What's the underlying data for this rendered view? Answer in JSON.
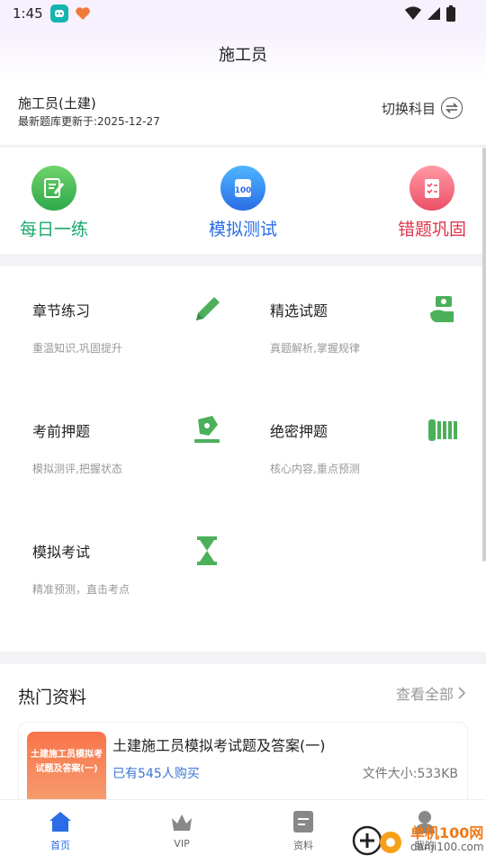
{
  "status_bar": {
    "time": "1:45"
  },
  "header": {
    "title": "施工员"
  },
  "subject": {
    "name": "施工员(土建)",
    "update_text": "最新题库更新于:2025-12-27",
    "switch_label": "切换科目"
  },
  "quick_actions": [
    {
      "label": "每日一练",
      "color": "#19a96a",
      "icon": "daily-practice-icon"
    },
    {
      "label": "模拟测试",
      "color": "#2a6de6",
      "icon": "mock-test-icon"
    },
    {
      "label": "错题巩固",
      "color": "#e0344a",
      "icon": "wrong-questions-icon"
    }
  ],
  "grid": [
    {
      "title": "章节练习",
      "subtitle": "重温知识,巩固提升",
      "icon": "pencil-icon"
    },
    {
      "title": "精选试题",
      "subtitle": "真题解析,掌握规律",
      "icon": "money-hand-icon"
    },
    {
      "title": "考前押题",
      "subtitle": "模拟测评,把握状态",
      "icon": "pen-nib-icon"
    },
    {
      "title": "绝密押题",
      "subtitle": "核心内容,重点预测",
      "icon": "scroll-icon"
    },
    {
      "title": "模拟考试",
      "subtitle": "精准预测，直击考点",
      "icon": "hourglass-icon"
    }
  ],
  "hot": {
    "title": "热门资料",
    "more_label": "查看全部",
    "items": [
      {
        "thumb_text": "土建施工员模拟考试题及答案(一)",
        "name": "土建施工员模拟考试题及答案(一)",
        "buyers": "已有545人购买",
        "size": "文件大小:533KB"
      }
    ]
  },
  "bottom_nav": [
    {
      "label": "首页",
      "icon": "home-icon",
      "active": true
    },
    {
      "label": "VIP",
      "icon": "crown-icon",
      "active": false
    },
    {
      "label": "资料",
      "icon": "document-icon",
      "active": false
    },
    {
      "label": "我的",
      "icon": "user-icon",
      "active": false
    }
  ],
  "watermark": {
    "line1": "单机100网",
    "line2": "danji100.com"
  },
  "colors": {
    "accent_blue": "#2a6de6",
    "green": "#4cb05a",
    "red": "#e0344a"
  }
}
